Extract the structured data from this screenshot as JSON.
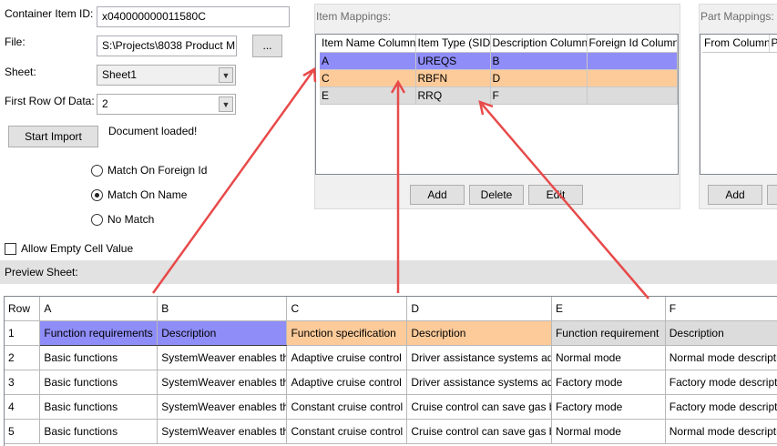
{
  "form": {
    "container_item_id_label": "Container Item ID:",
    "container_item_id_value": "x040000000011580C",
    "file_label": "File:",
    "file_value": "S:\\Projects\\8038 Product M",
    "browse_label": "...",
    "sheet_label": "Sheet:",
    "sheet_value": "Sheet1",
    "first_row_label": "First Row Of Data:",
    "first_row_value": "2",
    "start_import_label": "Start Import",
    "status_text": "Document loaded!",
    "match_options": [
      {
        "label": "Match On Foreign Id",
        "selected": false
      },
      {
        "label": "Match On Name",
        "selected": true
      },
      {
        "label": "No Match",
        "selected": false
      }
    ],
    "allow_empty_label": "Allow Empty Cell Value",
    "allow_empty_checked": false,
    "preview_sheet_label": "Preview Sheet:"
  },
  "item_mappings": {
    "title": "Item Mappings:",
    "columns": [
      "Item Name Column",
      "Item Type (SID)",
      "Description Column",
      "Foreign Id Column"
    ],
    "rows": [
      {
        "cells": [
          "A",
          "UREQS",
          "B",
          ""
        ],
        "color": "#8f8df8"
      },
      {
        "cells": [
          "C",
          "RBFN",
          "D",
          ""
        ],
        "color": "#fdcb9a"
      },
      {
        "cells": [
          "E",
          "RRQ",
          "F",
          ""
        ],
        "color": "#dcdcdc"
      }
    ],
    "buttons": {
      "add": "Add",
      "delete": "Delete",
      "edit": "Edit"
    }
  },
  "part_mappings": {
    "title": "Part Mappings:",
    "columns": [
      "From Column",
      "Pa"
    ],
    "buttons": {
      "add": "Add"
    }
  },
  "preview": {
    "columns": [
      "Row",
      "A",
      "B",
      "C",
      "D",
      "E",
      "F"
    ],
    "rows": [
      [
        "1",
        "Function requirements",
        "Description",
        "Function specification",
        "Description",
        "Function requirement",
        "Description"
      ],
      [
        "2",
        "Basic functions",
        "SystemWeaver enables th",
        "Adaptive cruise control",
        "Driver assistance systems ad",
        "Normal mode",
        "Normal mode description"
      ],
      [
        "3",
        "Basic functions",
        "SystemWeaver enables th",
        "Adaptive cruise control",
        "Driver assistance systems ad",
        "Factory mode",
        "Factory mode description"
      ],
      [
        "4",
        "Basic functions",
        "SystemWeaver enables th",
        "Constant cruise control",
        "Cruise control can save gas b",
        "Factory mode",
        "Factory mode description"
      ],
      [
        "5",
        "Basic functions",
        "SystemWeaver enables th",
        "Constant cruise control",
        "Cruise control can save gas b",
        "Normal mode",
        "Normal mode description"
      ]
    ]
  },
  "colors": {
    "blue_mapping": "#8f8df8",
    "orange_mapping": "#fdcb9a",
    "gray_mapping": "#dcdcdc",
    "arrow": "#e84a4a"
  }
}
